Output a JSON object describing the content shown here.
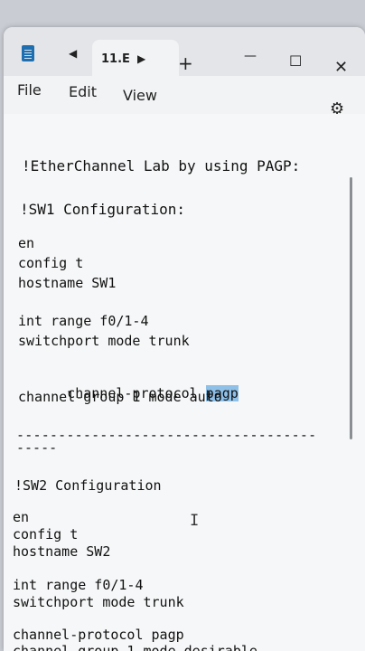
{
  "tab": {
    "title": "11.E"
  },
  "titlebar": {
    "back_glyph": "◀",
    "forward_glyph": "▶",
    "new_tab_glyph": "+",
    "minimize_glyph": "—",
    "maximize_glyph": "☐",
    "close_glyph": "✕"
  },
  "menu": {
    "file": "File",
    "edit": "Edit",
    "view": "View",
    "settings_glyph": "⚙"
  },
  "editor": {
    "lines": [
      "!EtherChannel Lab by using PAGP:",
      "!SW1 Configuration:",
      "en",
      "config t",
      "hostname SW1",
      "int range f0/1-4",
      "switchport mode trunk",
      "channel-protocol ",
      "pagp",
      "channel-group 1 mode auto",
      "------------------------------------",
      "-----",
      "!SW2 Configuration",
      "en",
      "config t",
      "hostname SW2",
      "int range f0/1-4",
      "switchport mode trunk",
      "channel-protocol pagp",
      "channel-group 1 mode desirable"
    ],
    "cursor_glyph": "I"
  }
}
